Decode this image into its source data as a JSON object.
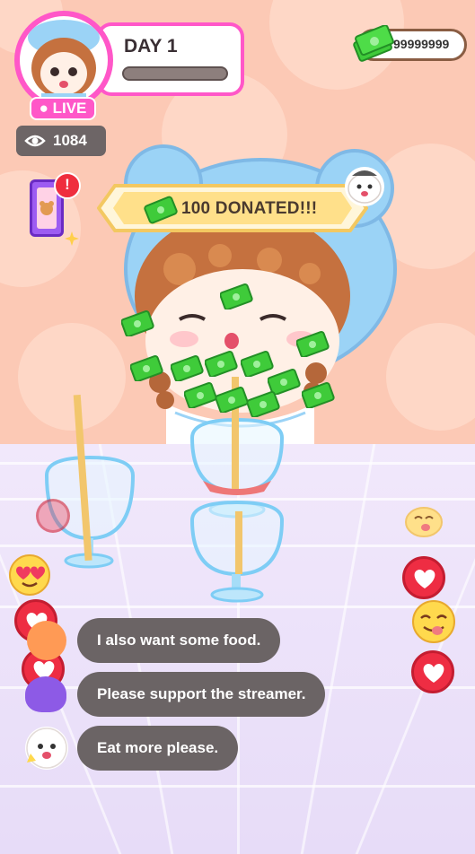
{
  "header": {
    "day_label": "DAY 1",
    "live_label": "LIVE",
    "viewer_count": "1084",
    "money": "99999999"
  },
  "donation": {
    "text": "100 DONATED!!!"
  },
  "chat": {
    "messages": [
      {
        "text": "I also want some food."
      },
      {
        "text": "Please support the streamer."
      },
      {
        "text": "Eat more please."
      }
    ]
  },
  "icons": {
    "eye": "eye-icon",
    "cash": "cash-stack-icon",
    "alert": "!",
    "heart": "heart-icon"
  },
  "colors": {
    "accent_pink": "#ff57c8",
    "background_peach": "#fcc9b5",
    "floor_lavender": "#ece2fa",
    "chat_bubble": "#6b6465",
    "heart_red": "#ee2d43",
    "cash_green": "#3fcb3a"
  }
}
